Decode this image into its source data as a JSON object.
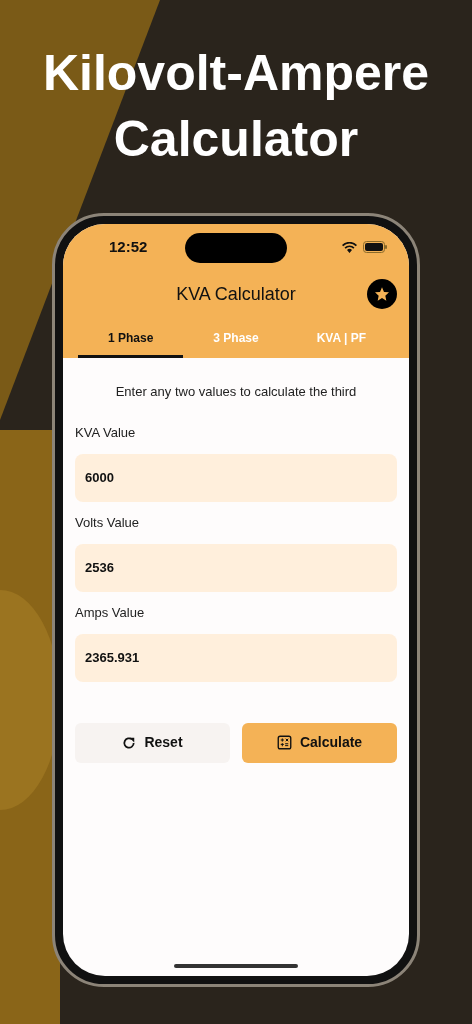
{
  "headline": "Kilovolt-Ampere Calculator",
  "status_bar": {
    "time": "12:52"
  },
  "app_bar": {
    "title": "KVA Calculator"
  },
  "tabs": [
    {
      "label": "1 Phase",
      "selected": true
    },
    {
      "label": "3 Phase",
      "selected": false
    },
    {
      "label": "KVA | PF",
      "selected": false
    }
  ],
  "instruction": "Enter any two values to calculate the third",
  "fields": [
    {
      "label": "KVA Value",
      "value": "6000"
    },
    {
      "label": "Volts Value",
      "value": "2536"
    },
    {
      "label": "Amps Value",
      "value": "2365.931"
    }
  ],
  "buttons": [
    {
      "kind": "reset",
      "label": "Reset"
    },
    {
      "kind": "calculate",
      "label": "Calculate"
    }
  ]
}
